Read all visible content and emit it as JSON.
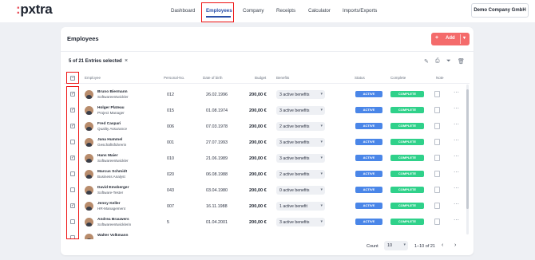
{
  "logo": {
    "text": ":pxtra"
  },
  "nav": {
    "items": [
      {
        "label": "Dashboard"
      },
      {
        "label": "Employees"
      },
      {
        "label": "Company"
      },
      {
        "label": "Receipts"
      },
      {
        "label": "Calculator"
      },
      {
        "label": "Imports/Exports"
      }
    ],
    "active_index": 1,
    "company": "Demo Company GmbH"
  },
  "page": {
    "title": "Employees",
    "add_label": "Add"
  },
  "selection": {
    "text": "5 of 21 Entries selected"
  },
  "icons": [
    "edit-icon",
    "print-icon",
    "filter-icon",
    "trash-icon"
  ],
  "table": {
    "headers": {
      "employee": "Employee",
      "personal_no": "Personal-No.",
      "dob": "Date of birth",
      "budget": "Budget",
      "benefits": "Benefits",
      "status": "Status",
      "complete": "Complete",
      "note": "Note"
    },
    "rows": [
      {
        "name": "Bruno Biermann",
        "role": "Softwareentwickler",
        "no": "012",
        "dob": "26.02.1996",
        "budget": "200,00 €",
        "benefits": "3 active benefits",
        "status": "ACTIVE",
        "complete": "COMPLETE",
        "checked": true
      },
      {
        "name": "Holger Plateau",
        "role": "Project Manager",
        "no": "015",
        "dob": "01.08.1974",
        "budget": "200,00 €",
        "benefits": "3 active benefits",
        "status": "ACTIVE",
        "complete": "COMPLETE",
        "checked": true
      },
      {
        "name": "Fred Caspari",
        "role": "Quality Assurance",
        "no": "006",
        "dob": "07.03.1978",
        "budget": "200,00 €",
        "benefits": "2 active benefits",
        "status": "ACTIVE",
        "complete": "COMPLETE",
        "checked": true
      },
      {
        "name": "Jana Hummel",
        "role": "Geschäftsführerin",
        "no": "001",
        "dob": "27.07.1993",
        "budget": "200,00 €",
        "benefits": "3 active benefits",
        "status": "ACTIVE",
        "complete": "COMPLETE",
        "checked": false
      },
      {
        "name": "Hans Maier",
        "role": "Softwareentwickler",
        "no": "010",
        "dob": "21.06.1989",
        "budget": "200,00 €",
        "benefits": "3 active benefits",
        "status": "ACTIVE",
        "complete": "COMPLETE",
        "checked": true
      },
      {
        "name": "Marcus Schmidt",
        "role": "Business Analyst",
        "no": "020",
        "dob": "06.08.1988",
        "budget": "200,00 €",
        "benefits": "2 active benefits",
        "status": "ACTIVE",
        "complete": "COMPLETE",
        "checked": false
      },
      {
        "name": "David Emsberger",
        "role": "Software-Tester",
        "no": "043",
        "dob": "03.04.1980",
        "budget": "200,00 €",
        "benefits": "0 active benefits",
        "status": "ACTIVE",
        "complete": "COMPLETE",
        "checked": false
      },
      {
        "name": "Jenny Keller",
        "role": "HR-Management",
        "no": "007",
        "dob": "16.11.1988",
        "budget": "200,00 €",
        "benefits": "1 active benefit",
        "status": "ACTIVE",
        "complete": "COMPLETE",
        "checked": true
      },
      {
        "name": "Andrea Brauwers",
        "role": "Softwareentwicklerin",
        "no": "5",
        "dob": "01.04.2001",
        "budget": "200,00 €",
        "benefits": "3 active benefits",
        "status": "ACTIVE",
        "complete": "COMPLETE",
        "checked": false
      },
      {
        "name": "Walter Volkmann",
        "role": "",
        "no": "",
        "dob": "",
        "budget": "",
        "benefits": "",
        "status": "",
        "complete": "",
        "checked": false
      }
    ]
  },
  "footer": {
    "count_label": "Count",
    "count_value": "10",
    "range": "1–10 of 21"
  }
}
